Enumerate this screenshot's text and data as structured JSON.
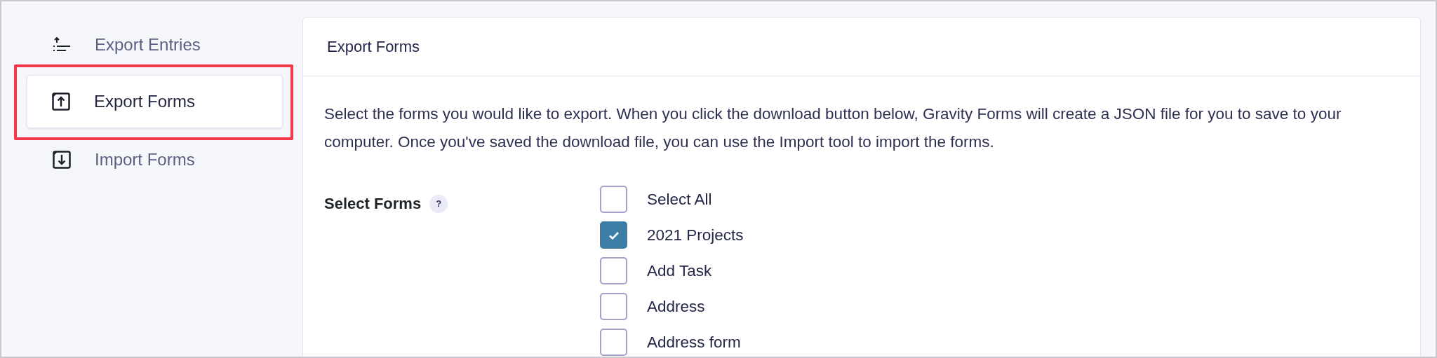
{
  "sidebar": {
    "items": [
      {
        "label": "Export Entries",
        "kind": "entries",
        "selected": false,
        "highlighted": false
      },
      {
        "label": "Export Forms",
        "kind": "export",
        "selected": true,
        "highlighted": true
      },
      {
        "label": "Import Forms",
        "kind": "import",
        "selected": false,
        "highlighted": false
      }
    ]
  },
  "card": {
    "title": "Export Forms",
    "description": "Select the forms you would like to export. When you click the download button below, Gravity Forms will create a JSON file for you to save to your computer. Once you've saved the download file, you can use the Import tool to import the forms.",
    "field": {
      "label": "Select Forms",
      "help": "?",
      "options": [
        {
          "label": "Select All",
          "checked": false
        },
        {
          "label": "2021 Projects",
          "checked": true
        },
        {
          "label": "Add Task",
          "checked": false
        },
        {
          "label": "Address",
          "checked": false
        },
        {
          "label": "Address form",
          "checked": false
        }
      ]
    }
  }
}
